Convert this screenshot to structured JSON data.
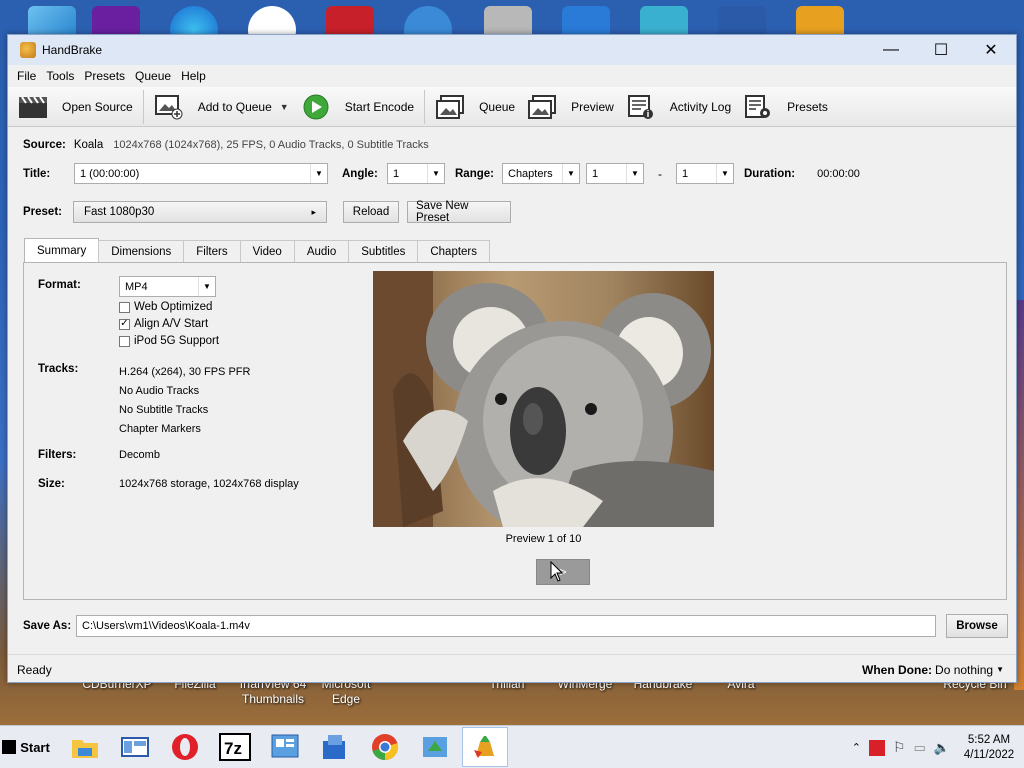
{
  "desktop": {
    "labels": [
      "CDBurnerXP",
      "FileZilla",
      "IrfanView 64 Thumbnails",
      "Microsoft Edge",
      "Trillian",
      "WinMerge",
      "Handbrake",
      "Avira",
      "Recycle Bin"
    ]
  },
  "window": {
    "title": "HandBrake",
    "controls": {
      "minimize": "—",
      "maximize": "☐",
      "close": "✕"
    }
  },
  "menu": [
    "File",
    "Tools",
    "Presets",
    "Queue",
    "Help"
  ],
  "toolbar": {
    "open_source": "Open Source",
    "add_to_queue": "Add to Queue",
    "start_encode": "Start Encode",
    "queue": "Queue",
    "preview": "Preview",
    "activity_log": "Activity Log",
    "presets": "Presets"
  },
  "source": {
    "label": "Source:",
    "name": "Koala",
    "info": "1024x768 (1024x768), 25 FPS, 0 Audio Tracks, 0 Subtitle Tracks"
  },
  "title_row": {
    "title_label": "Title:",
    "title_value": "1  (00:00:00)",
    "angle_label": "Angle:",
    "angle_value": "1",
    "range_label": "Range:",
    "range_value": "Chapters",
    "range_start": "1",
    "range_dash": "-",
    "range_end": "1",
    "duration_label": "Duration:",
    "duration_value": "00:00:00"
  },
  "preset": {
    "label": "Preset:",
    "value": "Fast 1080p30",
    "reload": "Reload",
    "save_new": "Save New Preset"
  },
  "tabs": [
    "Summary",
    "Dimensions",
    "Filters",
    "Video",
    "Audio",
    "Subtitles",
    "Chapters"
  ],
  "summary": {
    "format_label": "Format:",
    "format_value": "MP4",
    "web_optimized": "Web Optimized",
    "align_av": "Align A/V Start",
    "ipod": "iPod 5G Support",
    "tracks_label": "Tracks:",
    "tracks": [
      "H.264 (x264), 30 FPS PFR",
      "No Audio Tracks",
      "No Subtitle Tracks",
      "Chapter Markers"
    ],
    "filters_label": "Filters:",
    "filters_value": "Decomb",
    "size_label": "Size:",
    "size_value": "1024x768 storage, 1024x768 display",
    "preview_caption": "Preview 1 of 10",
    "next_button": ">"
  },
  "save_as": {
    "label": "Save As:",
    "path": "C:\\Users\\vm1\\Videos\\Koala-1.m4v",
    "browse": "Browse"
  },
  "status": {
    "text": "Ready",
    "when_done_label": "When Done:",
    "when_done_value": "Do nothing"
  },
  "taskbar": {
    "start": "Start",
    "time": "5:52 AM",
    "date": "4/11/2022"
  }
}
